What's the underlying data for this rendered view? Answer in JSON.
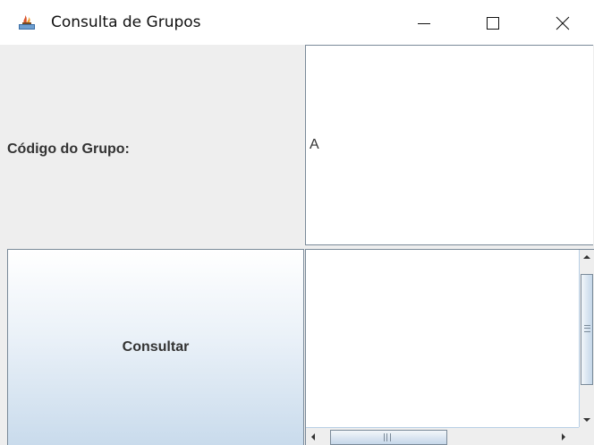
{
  "window": {
    "title": "Consulta de Grupos",
    "icon": "java-app-icon",
    "controls": [
      "minimize-icon",
      "maximize-icon",
      "close-icon"
    ]
  },
  "form": {
    "code_label": "Código do Grupo:",
    "code_value": "A",
    "consult_label": "Consultar",
    "result_text": ""
  },
  "colors": {
    "window_bg": "#eeeeee",
    "field_bg": "#ffffff",
    "border": "#7a8a99",
    "button_gradient_top": "#ffffff",
    "button_gradient_bottom": "#c9dbec",
    "label_text": "#333333"
  }
}
